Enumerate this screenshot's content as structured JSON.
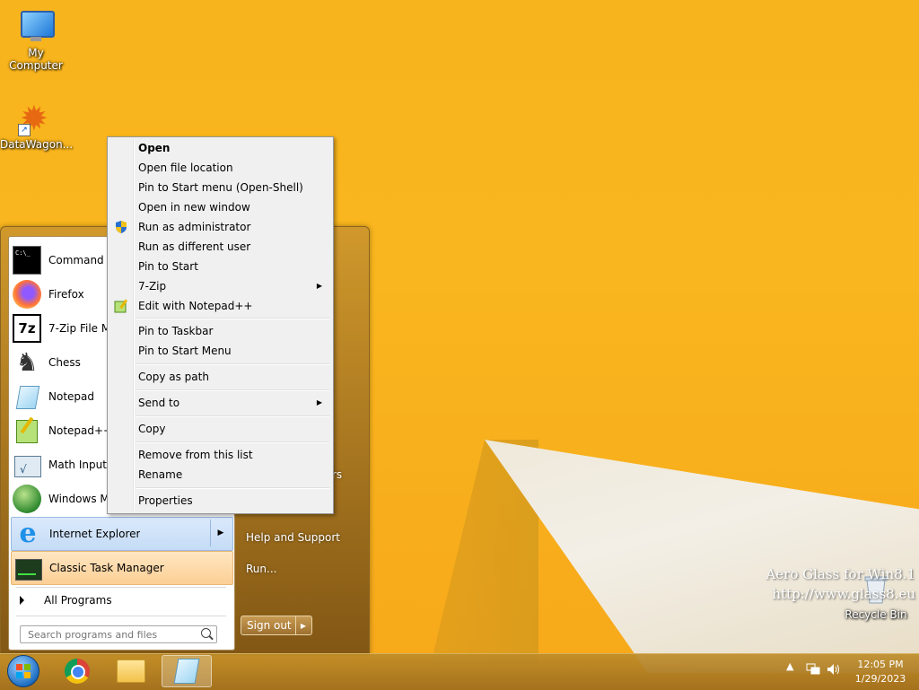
{
  "desktop": {
    "icons": [
      {
        "label": "My Computer",
        "icon": "computer-icon"
      },
      {
        "label": "DataWagon...",
        "icon": "datawagon-icon"
      },
      {
        "label": "Recycle Bin",
        "icon": "recycle-bin-icon"
      }
    ],
    "watermark": {
      "line1": "Aero Glass for Win8.1",
      "line2": "http://www.glass8.eu"
    }
  },
  "start_menu": {
    "programs": [
      {
        "label": "Command Prompt",
        "icon": "command-prompt-icon"
      },
      {
        "label": "Firefox",
        "icon": "firefox-icon"
      },
      {
        "label": "7-Zip File Manager",
        "icon": "7zip-icon"
      },
      {
        "label": "Chess",
        "icon": "chess-icon"
      },
      {
        "label": "Notepad",
        "icon": "notepad-icon"
      },
      {
        "label": "Notepad++",
        "icon": "notepadpp-icon"
      },
      {
        "label": "Math Input Panel",
        "icon": "math-input-icon"
      },
      {
        "label": "Windows Media Center",
        "icon": "windows-media-icon"
      },
      {
        "label": "Internet Explorer",
        "icon": "internet-explorer-icon"
      },
      {
        "label": "Classic Task Manager",
        "icon": "task-manager-icon"
      }
    ],
    "all_programs": "All Programs",
    "search_placeholder": "Search programs and files",
    "right_links": {
      "partial": "rs",
      "help": "Help and Support",
      "run": "Run..."
    },
    "sign_out": "Sign out"
  },
  "context_menu": {
    "items": [
      {
        "label": "Open",
        "bold": true
      },
      {
        "label": "Open file location"
      },
      {
        "label": "Pin to Start menu (Open-Shell)"
      },
      {
        "label": "Open in new window"
      },
      {
        "label": "Run as administrator",
        "icon": "uac-shield-icon"
      },
      {
        "label": "Run as different user"
      },
      {
        "label": "Pin to Start"
      },
      {
        "label": "7-Zip",
        "submenu": true
      },
      {
        "label": "Edit with Notepad++",
        "icon": "notepadpp-icon"
      },
      {
        "label": "Pin to Taskbar"
      },
      {
        "label": "Pin to Start Menu"
      },
      {
        "label": "Copy as path"
      },
      {
        "label": "Send to",
        "submenu": true
      },
      {
        "label": "Copy"
      },
      {
        "label": "Remove from this list"
      },
      {
        "label": "Rename"
      },
      {
        "label": "Properties"
      }
    ]
  },
  "taskbar": {
    "buttons": [
      {
        "name": "start-orb",
        "icon": "windows-start-icon"
      },
      {
        "name": "chrome",
        "icon": "chrome-icon"
      },
      {
        "name": "file-explorer",
        "icon": "folder-icon"
      },
      {
        "name": "notepad",
        "icon": "notepad-icon",
        "active": true
      }
    ],
    "clock": {
      "time": "12:05 PM",
      "date": "1/29/2023"
    }
  }
}
